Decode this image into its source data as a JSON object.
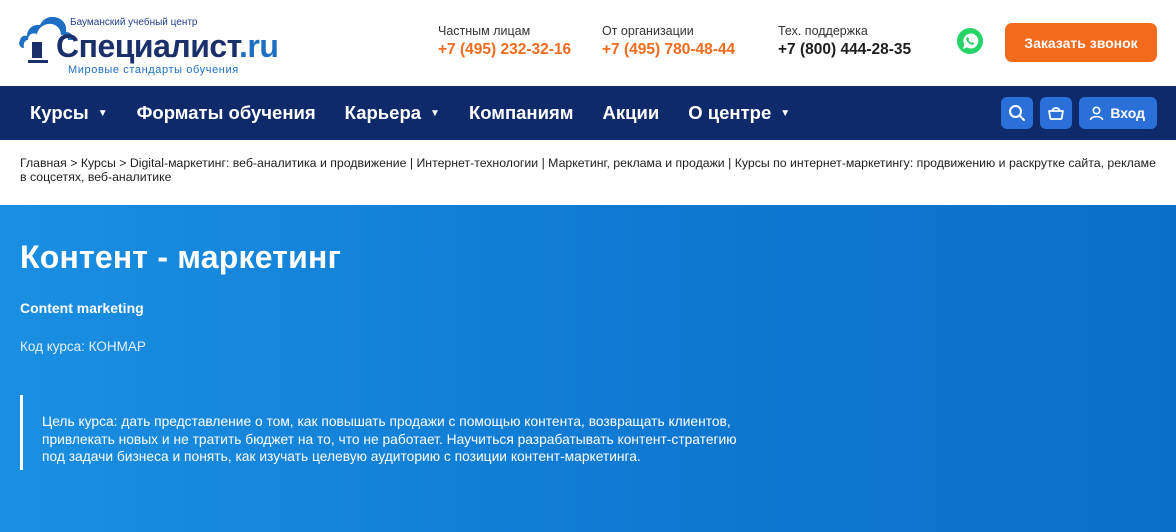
{
  "header": {
    "logo": {
      "top_text": "Бауманский учебный центр",
      "name_main": "Специалист",
      "name_suffix": ".ru",
      "tagline": "Мировые стандарты обучения"
    },
    "contacts": [
      {
        "label": "Частным лицам",
        "phone": "+7 (495) 232-32-16",
        "color": "orange"
      },
      {
        "label": "От организации",
        "phone": "+7 (495) 780-48-44",
        "color": "orange"
      },
      {
        "label": "Тех. поддержка",
        "phone": "+7 (800) 444-28-35",
        "color": "dark"
      }
    ],
    "whatsapp_icon": "whatsapp-icon",
    "callback_label": "Заказать звонок"
  },
  "nav": {
    "items": [
      {
        "label": "Курсы",
        "dropdown": true
      },
      {
        "label": "Форматы обучения",
        "dropdown": false
      },
      {
        "label": "Карьера",
        "dropdown": true
      },
      {
        "label": "Компаниям",
        "dropdown": false
      },
      {
        "label": "Акции",
        "dropdown": false
      },
      {
        "label": "О центре",
        "dropdown": true
      }
    ],
    "search_icon": "search-icon",
    "cart_icon": "basket-icon",
    "login_label": "Вход"
  },
  "breadcrumb": {
    "text": "Главная > Курсы > Digital-маркетинг: веб-аналитика и продвижение | Интернет-технологии | Маркетинг, реклама и продажи | Курсы по интернет-маркетингу: продвижению и раскрутке сайта, рекламе в соцсетях, веб-аналитике"
  },
  "course": {
    "title": "Контент - маркетинг",
    "subtitle": "Content marketing",
    "code_label": "Код курса: КОНМАР",
    "goal": "Цель курса: дать представление о том, как повышать продажи с помощью контента, возвращать клиентов, привлекать новых и не тратить бюджет на то, что не работает. Научиться разрабатывать контент-стратегию под задачи бизнеса и понять, как изучать целевую аудиторию с позиции контент-маркетинга."
  },
  "colors": {
    "brand_dark": "#0f2a6b",
    "accent_orange": "#f26b1d",
    "hero_blue": "#0e79d2",
    "button_blue": "#2a70d8"
  }
}
